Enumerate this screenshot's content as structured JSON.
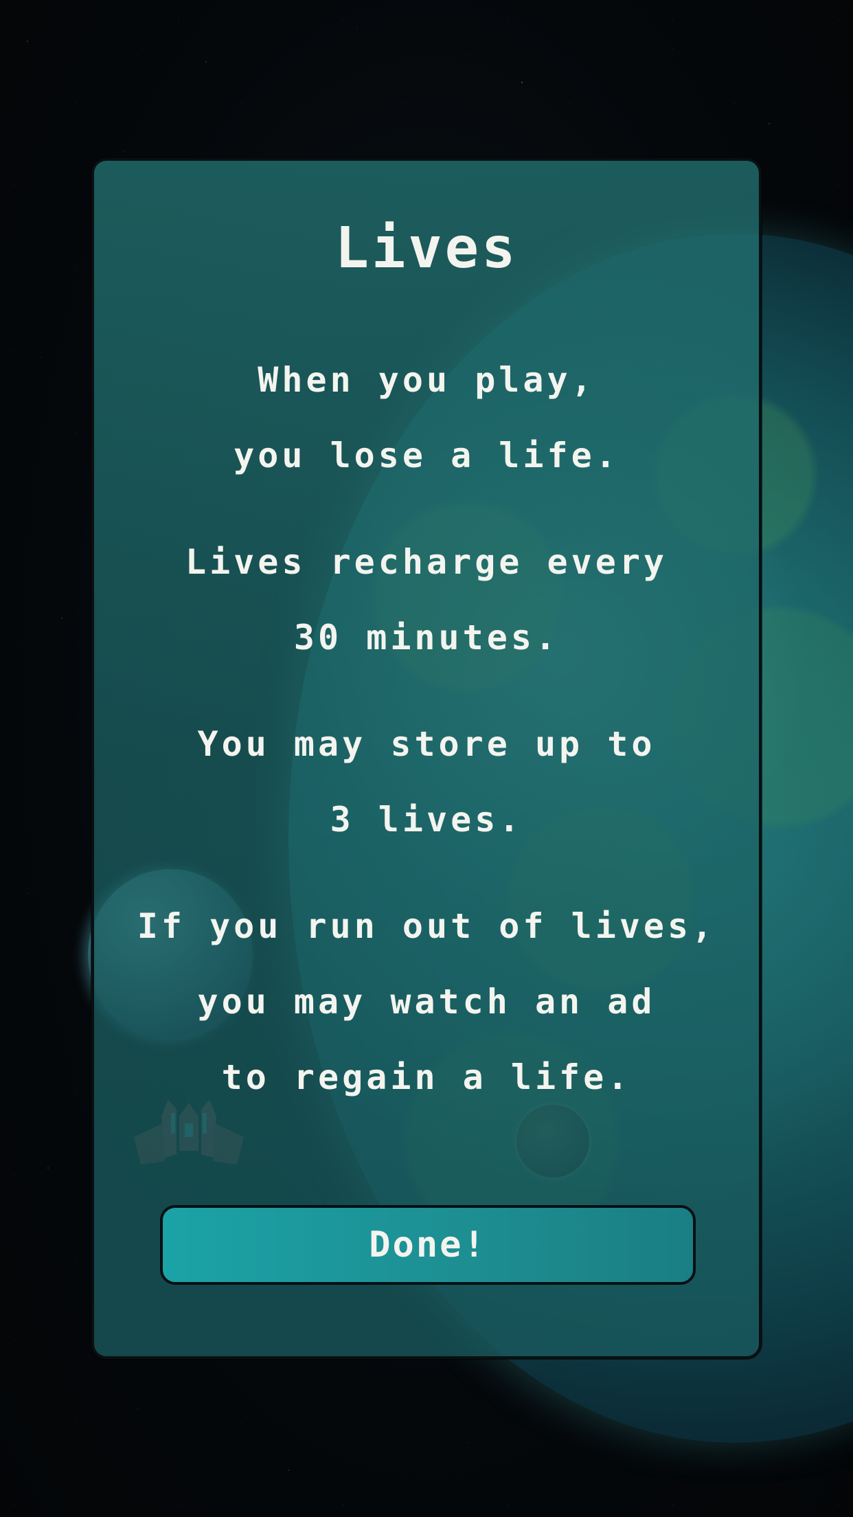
{
  "dialog": {
    "title": "Lives",
    "lines": [
      "When you play,",
      "you lose a life.",
      "Lives recharge every",
      "30 minutes.",
      "You may store up to",
      "3 lives.",
      "If you run out of lives,",
      "you may watch an ad",
      "to regain a life."
    ],
    "done_label": "Done!"
  },
  "background": {
    "ship_icon": "red-spaceship-icon"
  },
  "colors": {
    "panel": "#1f6f70",
    "button": "#1ba3a6",
    "text": "#f4f4ef",
    "border": "#0a0f12"
  }
}
